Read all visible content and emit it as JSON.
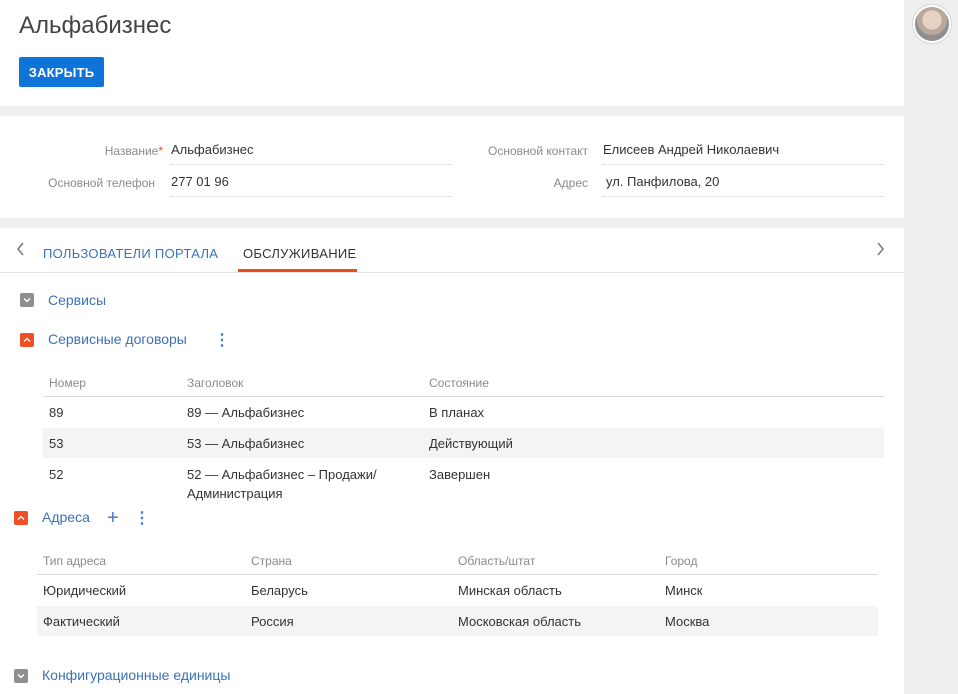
{
  "header": {
    "title": "Альфабизнес",
    "close_label": "ЗАКРЫТЬ"
  },
  "fields": {
    "name_label": "Название",
    "required_mark": "*",
    "name_value": "Альфабизнес",
    "phone_label": "Основной телефон",
    "phone_value": "277 01 96",
    "contact_label": "Основной контакт",
    "contact_value": "Елисеев Андрей Николаевич",
    "address_label": "Адрес",
    "address_value": "ул. Панфилова, 20"
  },
  "tabs": {
    "prev_arrow": "‹",
    "next_arrow": "›",
    "items": [
      {
        "label": "ПОЛЬЗОВАТЕЛИ ПОРТАЛА",
        "active": false
      },
      {
        "label": "ОБСЛУЖИВАНИЕ",
        "active": true
      }
    ]
  },
  "groups": {
    "services": {
      "title": "Сервисы",
      "expanded": false
    },
    "contracts": {
      "title": "Сервисные договоры",
      "expanded": true,
      "columns": [
        "Номер",
        "Заголовок",
        "Состояние"
      ],
      "rows": [
        {
          "number": "89",
          "title": "89 — Альфабизнес",
          "title2": "",
          "status": "В планах"
        },
        {
          "number": "53",
          "title": "53 — Альфабизнес",
          "title2": "",
          "status": "Действующий"
        },
        {
          "number": "52",
          "title": "52 — Альфабизнес – Продажи/",
          "title2": "Администрация",
          "status": "Завершен"
        }
      ]
    },
    "addresses": {
      "title": "Адреса",
      "expanded": true,
      "columns": [
        "Тип адреса",
        "Страна",
        "Область/штат",
        "Город"
      ],
      "rows": [
        {
          "type": "Юридический",
          "country": "Беларусь",
          "region": "Минская область",
          "city": "Минск"
        },
        {
          "type": "Фактический",
          "country": "Россия",
          "region": "Московская область",
          "city": "Москва"
        }
      ]
    },
    "config_items": {
      "title": "Конфигурационные единицы",
      "expanded": false
    }
  },
  "icons": {
    "kebab": "⋮",
    "plus": "+"
  },
  "colors": {
    "accent_blue": "#0f74d7",
    "link_blue": "#3b72b5",
    "accent_orange": "#e94e1b",
    "collapsed_gray": "#8f8f8f"
  }
}
